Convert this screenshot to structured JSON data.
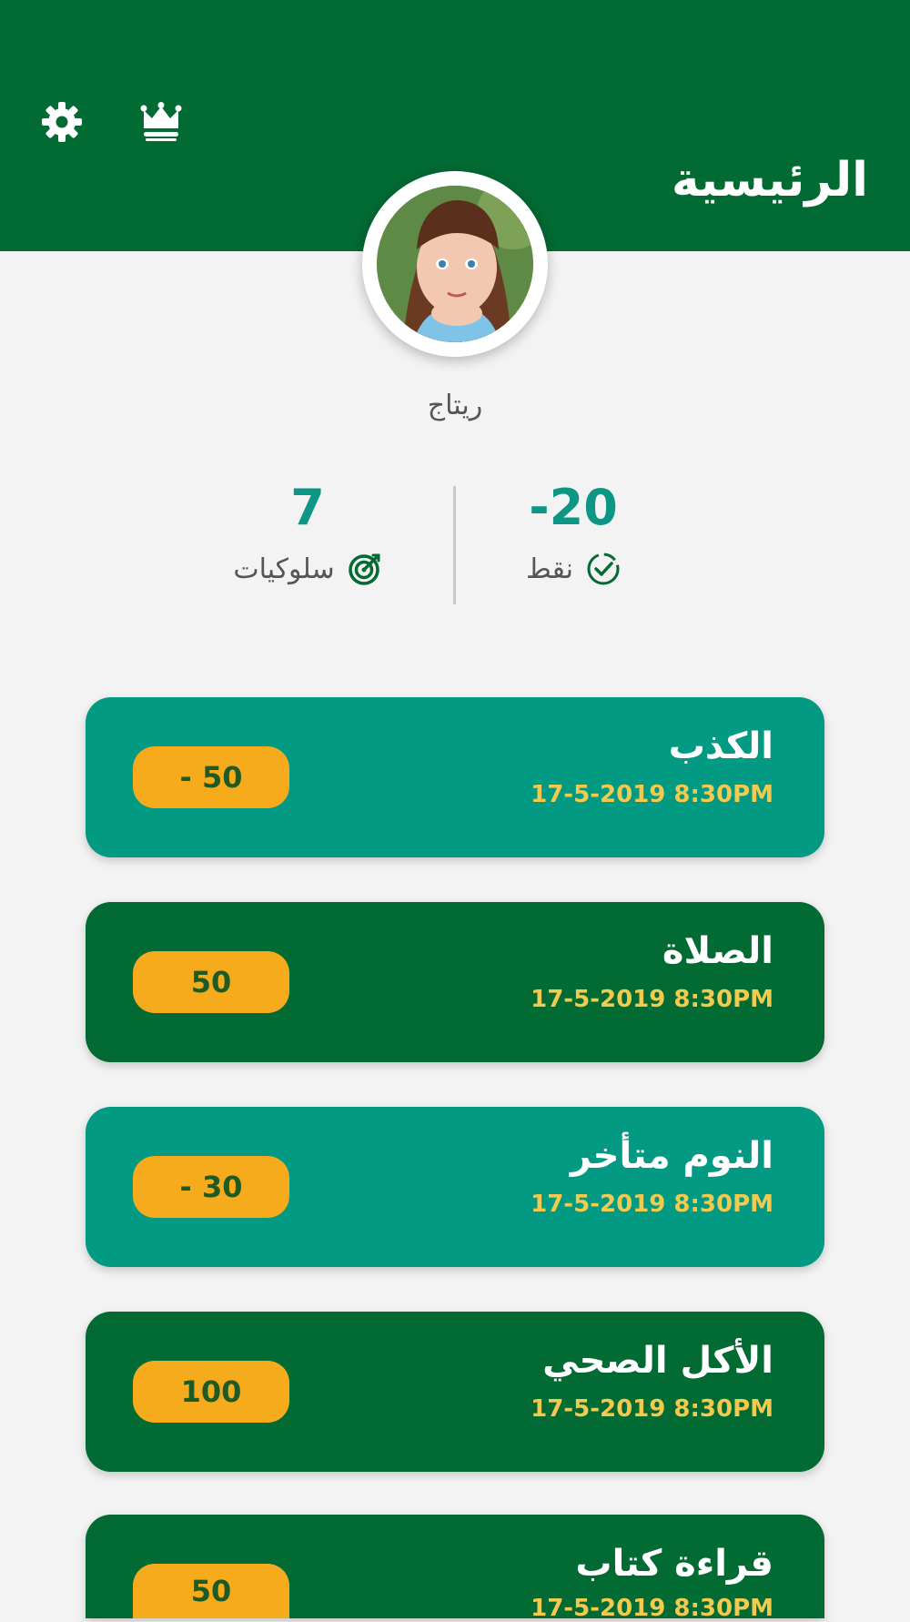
{
  "header": {
    "title": "الرئيسية",
    "settings_icon": "gear-icon",
    "crown_icon": "crown-icon",
    "background": "#026a33"
  },
  "profile": {
    "name": "ريتاج",
    "avatar": "child-photo"
  },
  "stats": {
    "behaviors_value": "7",
    "behaviors_label": "سلوكيات",
    "behaviors_icon": "target-icon",
    "points_value": "-20",
    "points_label": "نقط",
    "points_icon": "check-badge-icon",
    "value_color": "#0e9684"
  },
  "behaviors": [
    {
      "title": "الكذب",
      "date": "17-5-2019 8:30PM",
      "points": "- 50",
      "color": "#029a82"
    },
    {
      "title": "الصلاة",
      "date": "17-5-2019 8:30PM",
      "points": "50",
      "color": "#026a33"
    },
    {
      "title": "النوم متأخر",
      "date": "17-5-2019 8:30PM",
      "points": "- 30",
      "color": "#029a82"
    },
    {
      "title": "الأكل الصحي",
      "date": "17-5-2019 8:30PM",
      "points": "100",
      "color": "#026a33"
    },
    {
      "title": "قراءة كتاب",
      "date": "17-5-2019 8:30PM",
      "points": "50",
      "color": "#026a33"
    }
  ],
  "colors": {
    "badge": "#f5ab1b",
    "date_text": "#f3c94e",
    "page_background": "#f3f3f3"
  }
}
